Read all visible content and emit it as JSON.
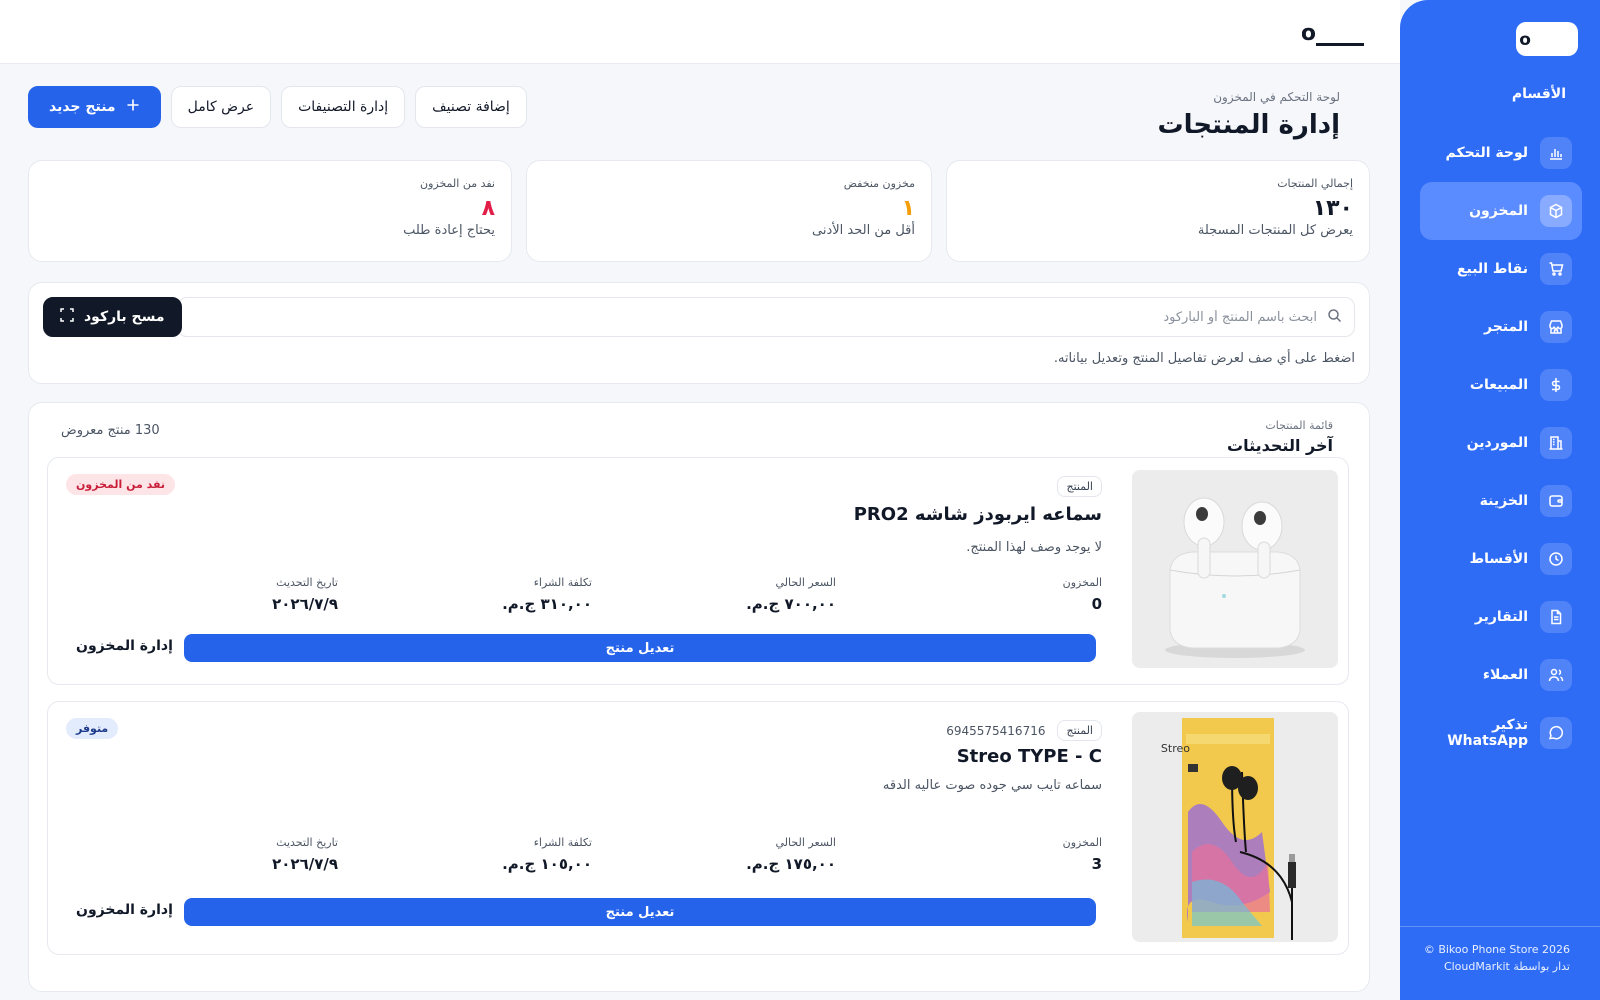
{
  "brand": {
    "logo_text": "Bikoo"
  },
  "sidebar": {
    "section_title": "الأقسام",
    "items": [
      {
        "label": "لوحة التحكم",
        "icon": "bar-chart-icon",
        "active": false
      },
      {
        "label": "المخزون",
        "icon": "box-icon",
        "active": true
      },
      {
        "label": "نقاط البيع",
        "icon": "cart-icon",
        "active": false
      },
      {
        "label": "المتجر",
        "icon": "store-icon",
        "active": false
      },
      {
        "label": "المبيعات",
        "icon": "dollar-icon",
        "active": false
      },
      {
        "label": "الموردين",
        "icon": "building-icon",
        "active": false
      },
      {
        "label": "الخزينة",
        "icon": "wallet-icon",
        "active": false
      },
      {
        "label": "الأقساط",
        "icon": "clock-icon",
        "active": false
      },
      {
        "label": "التقارير",
        "icon": "document-icon",
        "active": false
      },
      {
        "label": "العملاء",
        "icon": "users-icon",
        "active": false
      },
      {
        "label": "تذكير WhatsApp",
        "icon": "chat-icon",
        "active": false
      }
    ],
    "footer_line1": "Bikoo Phone Store 2026 ©",
    "footer_line2": "تدار بواسطة CloudMarkit"
  },
  "header": {
    "breadcrumb": "لوحة التحكم في المخزون",
    "title": "إدارة المنتجات",
    "actions": {
      "new_product": "منتج جديد",
      "full_view": "عرض كامل",
      "manage_categories": "إدارة التصنيفات",
      "add_category": "إضافة تصنيف"
    }
  },
  "stats": [
    {
      "label": "إجمالي المنتجات",
      "value": "١٣٠",
      "sub": "يعرض كل المنتجات المسجلة",
      "color": "#111827"
    },
    {
      "label": "مخزون منخفض",
      "value": "١",
      "sub": "أقل من الحد الأدنى",
      "color": "#f59e0b"
    },
    {
      "label": "نفد من المخزون",
      "value": "٨",
      "sub": "يحتاج إعادة طلب",
      "color": "#e11d48"
    }
  ],
  "search": {
    "placeholder": "ابحث باسم المنتج أو الباركود",
    "scan_label": "مسح باركود",
    "hint": "اضغط على أي صف لعرض تفاصيل المنتج وتعديل بياناته."
  },
  "product_list": {
    "caption": "قائمة المنتجات",
    "title": "آخر التحديثات",
    "count_text": "130 منتج معروض",
    "products": [
      {
        "tag": "المنتج",
        "barcode": "",
        "name": "سماعه ايربودز شاشه PRO2",
        "description": "لا يوجد وصف لهذا المنتج.",
        "status": "نفد من المخزون",
        "stock_label": "المخزون",
        "stock": "0",
        "price_label": "السعر الحالي",
        "price": "٧٠٠,٠٠ ج.م.",
        "cost_label": "تكلفة الشراء",
        "cost": "٣١٠,٠٠ ج.م.",
        "date_label": "تاريخ التحديث",
        "date": "٢٠٢٦/٧/٩",
        "edit_label": "تعديل منتج",
        "manage_label": "إدارة المخزون"
      },
      {
        "tag": "المنتج",
        "barcode": "6945575416716",
        "name": "Streo TYPE - C",
        "description": "سماعه تايب سي جوده صوت عاليه الدقه",
        "status": "متوفر",
        "stock_label": "المخزون",
        "stock": "3",
        "price_label": "السعر الحالي",
        "price": "١٧٥,٠٠ ج.م.",
        "cost_label": "تكلفة الشراء",
        "cost": "١٠٥,٠٠ ج.م.",
        "date_label": "تاريخ التحديث",
        "date": "٢٠٢٦/٧/٩",
        "edit_label": "تعديل منتج",
        "manage_label": "إدارة المخزون",
        "package_text": "Streo"
      }
    ]
  },
  "colors": {
    "primary": "#2563eb",
    "sidebar": "#2f6cf6",
    "danger": "#e11d48",
    "warning": "#f59e0b"
  }
}
